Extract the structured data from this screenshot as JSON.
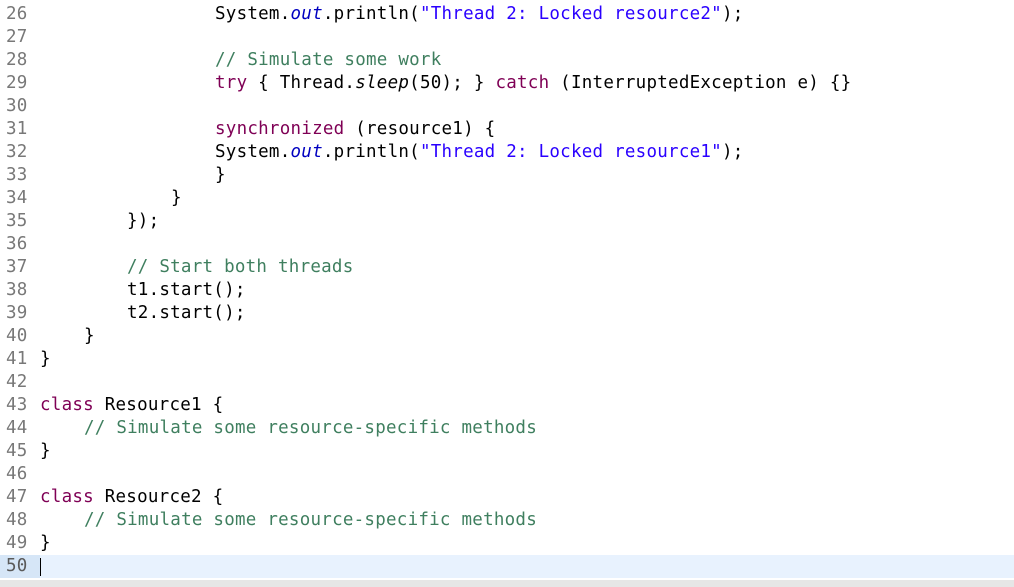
{
  "editor": {
    "current_line": "50",
    "lines": [
      {
        "num": "26",
        "tokens": [
          {
            "t": "        System.",
            "c": "plain"
          },
          {
            "t": "out",
            "c": "fld"
          },
          {
            "t": ".println(",
            "c": "plain"
          },
          {
            "t": "\"Thread 2: Locked resource2\"",
            "c": "str"
          },
          {
            "t": ");",
            "c": "plain"
          }
        ]
      },
      {
        "num": "27",
        "tokens": []
      },
      {
        "num": "28",
        "tokens": [
          {
            "t": "        // Simulate some work",
            "c": "cmt"
          }
        ]
      },
      {
        "num": "29",
        "tokens": [
          {
            "t": "        ",
            "c": "plain"
          },
          {
            "t": "try",
            "c": "kw"
          },
          {
            "t": " { Thread.",
            "c": "plain"
          },
          {
            "t": "sleep",
            "c": "sm"
          },
          {
            "t": "(50); } ",
            "c": "plain"
          },
          {
            "t": "catch",
            "c": "kw"
          },
          {
            "t": " (InterruptedException e) {}",
            "c": "plain"
          }
        ]
      },
      {
        "num": "30",
        "tokens": []
      },
      {
        "num": "31",
        "tokens": [
          {
            "t": "        ",
            "c": "plain"
          },
          {
            "t": "synchronized",
            "c": "kw"
          },
          {
            "t": " (resource1) {",
            "c": "plain"
          }
        ]
      },
      {
        "num": "32",
        "tokens": [
          {
            "t": "            System.",
            "c": "plain"
          },
          {
            "t": "out",
            "c": "fld"
          },
          {
            "t": ".println(",
            "c": "plain"
          },
          {
            "t": "\"Thread 2: Locked resource1\"",
            "c": "str"
          },
          {
            "t": ");",
            "c": "plain"
          }
        ]
      },
      {
        "num": "33",
        "tokens": [
          {
            "t": "        }",
            "c": "plain"
          }
        ]
      },
      {
        "num": "34",
        "tokens": [
          {
            "t": "    }",
            "c": "plain"
          }
        ]
      },
      {
        "num": "35",
        "tokens": [
          {
            "t": "});",
            "c": "plain"
          }
        ]
      },
      {
        "num": "36",
        "tokens": []
      },
      {
        "num": "37",
        "tokens": [
          {
            "t": "// Start both threads",
            "c": "cmt"
          }
        ]
      },
      {
        "num": "38",
        "tokens": [
          {
            "t": "t1.start();",
            "c": "plain"
          }
        ]
      },
      {
        "num": "39",
        "tokens": [
          {
            "t": "t2.start();",
            "c": "plain"
          }
        ]
      },
      {
        "num": "40",
        "tokens": [
          {
            "t": "}",
            "c": "plain"
          }
        ]
      },
      {
        "num": "41",
        "tokens": [
          {
            "t": "}",
            "c": "plain"
          }
        ]
      },
      {
        "num": "42",
        "tokens": []
      },
      {
        "num": "43",
        "tokens": [
          {
            "t": "class",
            "c": "kw"
          },
          {
            "t": " Resource1 {",
            "c": "plain"
          }
        ]
      },
      {
        "num": "44",
        "tokens": [
          {
            "t": "// Simulate some resource-specific methods",
            "c": "cmt"
          }
        ]
      },
      {
        "num": "45",
        "tokens": [
          {
            "t": "}",
            "c": "plain"
          }
        ]
      },
      {
        "num": "46",
        "tokens": []
      },
      {
        "num": "47",
        "tokens": [
          {
            "t": "class",
            "c": "kw"
          },
          {
            "t": " Resource2 {",
            "c": "plain"
          }
        ]
      },
      {
        "num": "48",
        "tokens": [
          {
            "t": "// Simulate some resource-specific methods",
            "c": "cmt"
          }
        ]
      },
      {
        "num": "49",
        "tokens": [
          {
            "t": "}",
            "c": "plain"
          }
        ]
      },
      {
        "num": "50",
        "tokens": []
      }
    ]
  }
}
